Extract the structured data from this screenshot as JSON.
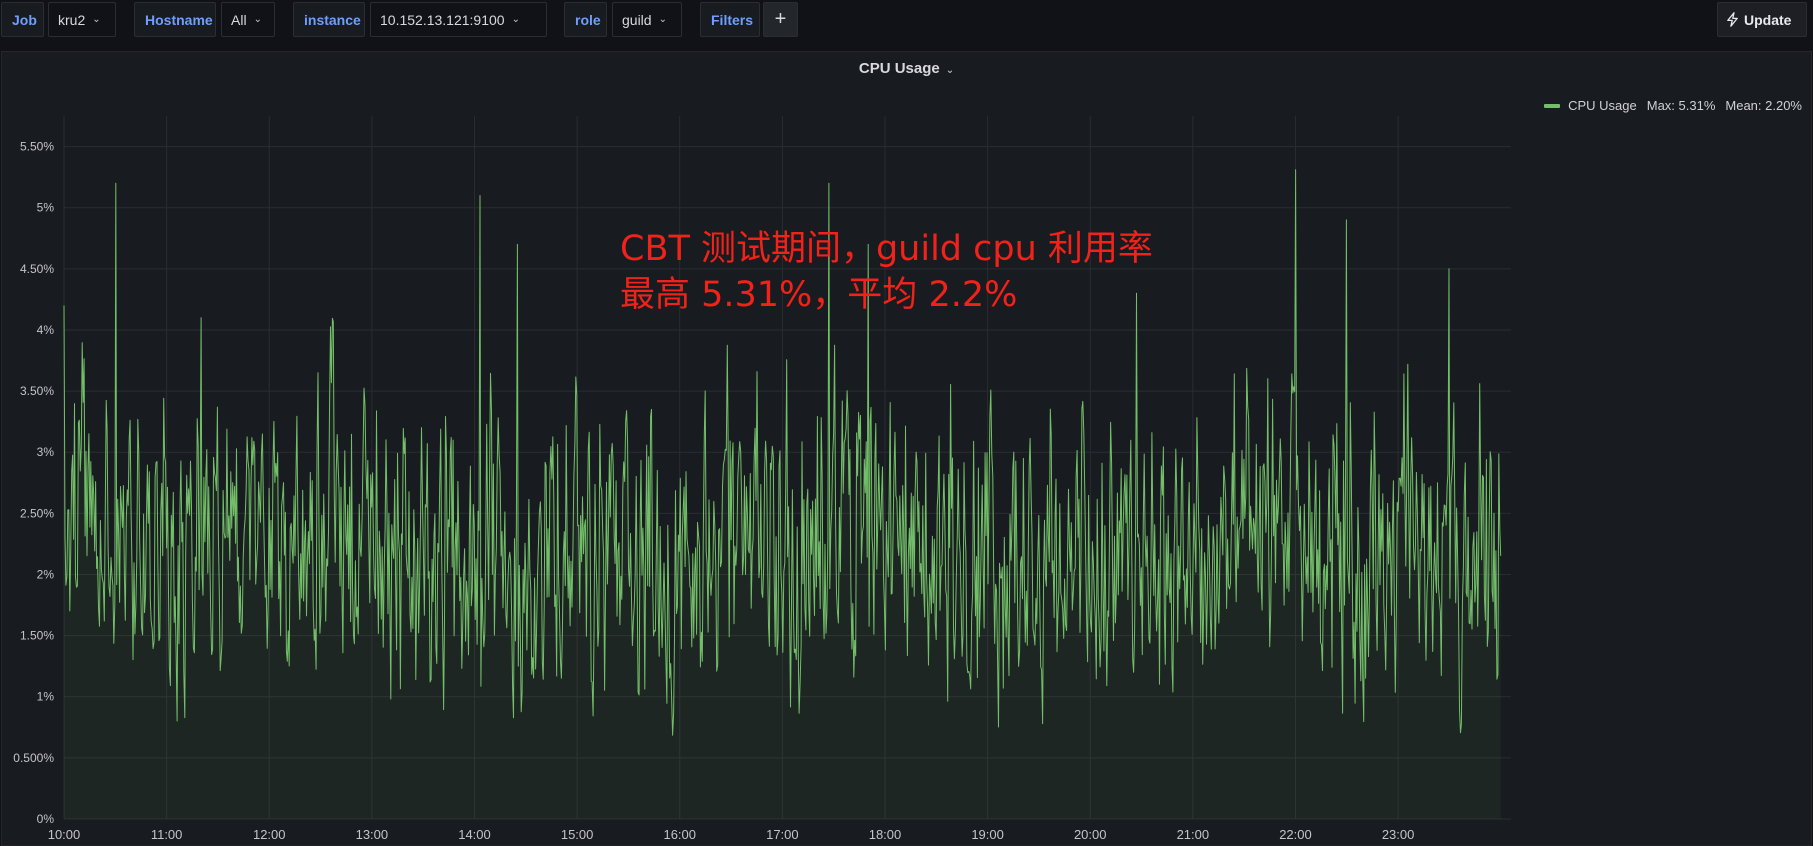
{
  "filters": {
    "job": {
      "label": "Job",
      "value": "kru2"
    },
    "hostname": {
      "label": "Hostname",
      "value": "All"
    },
    "instance": {
      "label": "instance",
      "value": "10.152.13.121:9100"
    },
    "role": {
      "label": "role",
      "value": "guild"
    },
    "filters_label": "Filters",
    "add_label": "+"
  },
  "update_label": "Update",
  "panel": {
    "title": "CPU Usage"
  },
  "legend": {
    "name": "CPU Usage",
    "max": "Max: 5.31%",
    "mean": "Mean: 2.20%",
    "color": "#73bf69"
  },
  "annotation": {
    "line1": "CBT 测试期间，guild cpu 利用率",
    "line2": "最高 5.31%，平均 2.2%",
    "color": "#f0221a"
  },
  "chart_data": {
    "type": "line",
    "title": "CPU Usage",
    "series": [
      {
        "name": "CPU Usage",
        "color": "#73bf69",
        "max": 5.31,
        "mean": 2.2
      }
    ],
    "ylim": [
      0,
      5.75
    ],
    "y_ticks": [
      0,
      0.5,
      1,
      1.5,
      2,
      2.5,
      3,
      3.5,
      4,
      4.5,
      5,
      5.5
    ],
    "y_tick_labels": [
      "0%",
      "0.500%",
      "1%",
      "1.50%",
      "2%",
      "2.50%",
      "3%",
      "3.50%",
      "4%",
      "4.50%",
      "5%",
      "5.50%"
    ],
    "x_tick_labels": [
      "10:00",
      "11:00",
      "12:00",
      "13:00",
      "14:00",
      "15:00",
      "16:00",
      "17:00",
      "18:00",
      "19:00",
      "20:00",
      "21:00",
      "22:00",
      "23:00"
    ],
    "x_range": [
      "10:00",
      "24:00"
    ],
    "peaks": [
      {
        "time": "10:00",
        "value": 4.2
      },
      {
        "time": "10:30",
        "value": 5.2
      },
      {
        "time": "11:20",
        "value": 4.1
      },
      {
        "time": "14:03",
        "value": 5.1
      },
      {
        "time": "14:25",
        "value": 4.7
      },
      {
        "time": "17:27",
        "value": 5.2
      },
      {
        "time": "17:50",
        "value": 4.7
      },
      {
        "time": "20:27",
        "value": 4.3
      },
      {
        "time": "22:00",
        "value": 5.31
      },
      {
        "time": "22:30",
        "value": 4.9
      },
      {
        "time": "23:30",
        "value": 4.5
      }
    ],
    "grid": true,
    "legend_position": "top-right"
  }
}
